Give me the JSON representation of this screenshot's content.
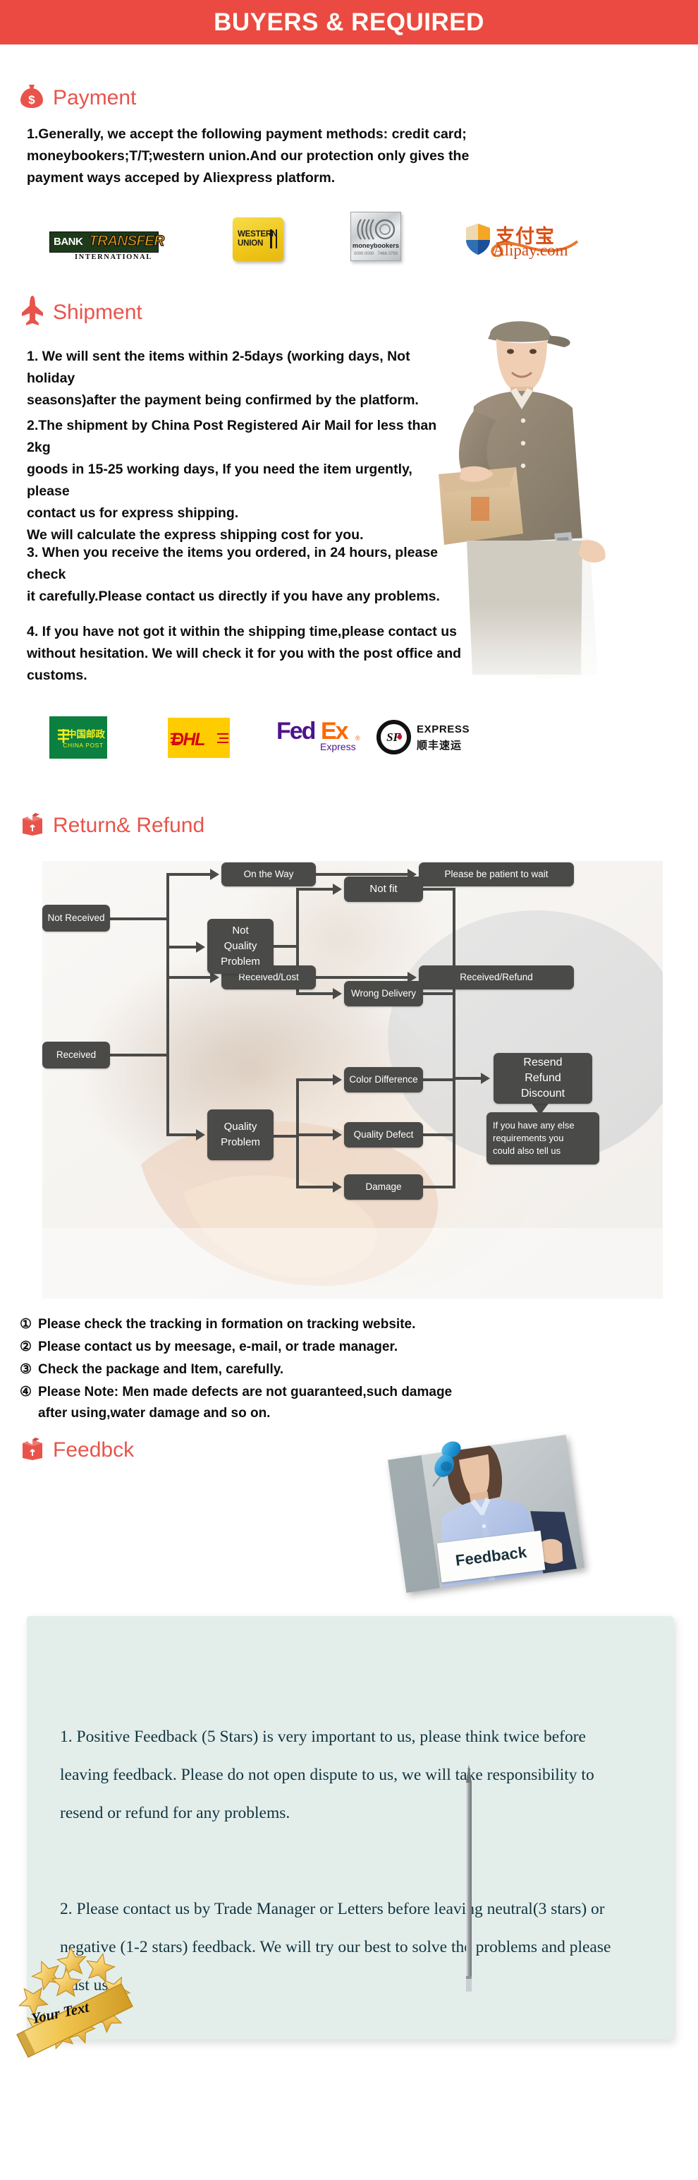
{
  "banner": {
    "title": "BUYERS & REQUIRED"
  },
  "colors": {
    "banner_bg": "#ea4a41",
    "heading_red": "#e8544b",
    "flow_node": "#4a4a48",
    "feedback_panel": "#e3eeeb",
    "feedback_text": "#12343f"
  },
  "sections": {
    "payment": {
      "icon": "money-bag-icon",
      "heading": "Payment",
      "paragraph": "1.Generally, we accept the following payment methods: credit card;\nmoneybookers;T/T;western union.And our protection only gives the\npayment ways acceped by Aliexpress platform.",
      "logos": [
        {
          "name": "bank-transfer-logo",
          "line1": "BANK",
          "line2": "TRANSFER",
          "line3": "INTERNATIONAL"
        },
        {
          "name": "western-union-logo",
          "line1": "WESTERN",
          "line2": "UNION"
        },
        {
          "name": "moneybookers-logo",
          "label": "moneybookers",
          "num_left": "0000 0000",
          "num_right": "7466 0793"
        },
        {
          "name": "alipay-logo",
          "label": "Alipay.com",
          "cn": "支付宝"
        }
      ]
    },
    "shipment": {
      "icon": "airplane-icon",
      "heading": "Shipment",
      "paragraphs": [
        "1. We will sent the items within 2-5days (working days, Not holiday\nseasons)after the payment being confirmed by the platform.",
        "2.The shipment by China Post Registered Air Mail for less than  2kg\ngoods in 15-25 working days, If  you need the item urgently, please\ncontact us for express shipping.\nWe will calculate the express shipping cost for you.",
        "3. When you receive the items you ordered, in 24 hours, please check\n it carefully.Please contact us directly if you have any problems.",
        "4. If you have not got it within the shipping time,please contact us\nwithout hesitation. We will check it for you with the post office and\ncustoms."
      ],
      "logos": [
        {
          "name": "china-post-logo",
          "cn": "中国邮政",
          "en": "CHINA POST"
        },
        {
          "name": "dhl-logo",
          "label": "DHL"
        },
        {
          "name": "fedex-logo",
          "part1": "Fed",
          "part2": "Ex",
          "reg": "®",
          "sub": "Express"
        },
        {
          "name": "sf-express-logo",
          "mark": "SF",
          "line1": "EXPRESS",
          "line2": "顺丰速运"
        }
      ]
    },
    "return_refund": {
      "icon": "return-box-icon",
      "heading": "Return& Refund",
      "flowchart": {
        "type": "flow",
        "nodes": [
          {
            "id": "not-received",
            "label": "Not Received"
          },
          {
            "id": "on-the-way",
            "label": "On the Way"
          },
          {
            "id": "please-wait",
            "label": "Please be patient to wait"
          },
          {
            "id": "received-lost",
            "label": "Received/Lost"
          },
          {
            "id": "received-refund",
            "label": "Received/Refund"
          },
          {
            "id": "received",
            "label": "Received"
          },
          {
            "id": "not-quality-problem",
            "label": "Not\nQuality\nProblem"
          },
          {
            "id": "quality-problem",
            "label": "Quality\nProblem"
          },
          {
            "id": "not-fit",
            "label": "Not fit"
          },
          {
            "id": "wrong-delivery",
            "label": "Wrong Delivery"
          },
          {
            "id": "color-difference",
            "label": "Color Difference"
          },
          {
            "id": "quality-defect",
            "label": "Quality Defect"
          },
          {
            "id": "damage",
            "label": "Damage"
          },
          {
            "id": "resend-refund-discount",
            "label": "Resend\nRefund\nDiscount"
          },
          {
            "id": "any-else-requirements",
            "label": "If you have any else\nrequirements you\ncould also tell us"
          }
        ],
        "edges": [
          [
            "not-received",
            "on-the-way"
          ],
          [
            "on-the-way",
            "please-wait"
          ],
          [
            "not-received",
            "received-lost"
          ],
          [
            "received-lost",
            "received-refund"
          ],
          [
            "received",
            "not-quality-problem"
          ],
          [
            "received",
            "quality-problem"
          ],
          [
            "not-quality-problem",
            "not-fit"
          ],
          [
            "not-quality-problem",
            "wrong-delivery"
          ],
          [
            "quality-problem",
            "color-difference"
          ],
          [
            "quality-problem",
            "quality-defect"
          ],
          [
            "quality-problem",
            "damage"
          ],
          [
            "not-fit",
            "resend-refund-discount"
          ],
          [
            "wrong-delivery",
            "resend-refund-discount"
          ],
          [
            "color-difference",
            "resend-refund-discount"
          ],
          [
            "quality-defect",
            "resend-refund-discount"
          ],
          [
            "damage",
            "resend-refund-discount"
          ]
        ]
      },
      "notes": [
        {
          "marker": "①",
          "text": "Please check the tracking in formation on tracking website."
        },
        {
          "marker": "②",
          "text": "Please contact us by meesage, e-mail, or trade manager."
        },
        {
          "marker": "③",
          "text": "Check the package and Item, carefully."
        },
        {
          "marker": "④",
          "text": "Please Note: Men made defects  are not guaranteed,such damage\n  after using,water damage and so on."
        }
      ]
    },
    "feedback": {
      "icon": "return-box-icon",
      "heading": "Feedbck",
      "photo_sign_label": "Feedback",
      "paragraphs": [
        "1. Positive Feedback (5 Stars) is very important to us, please think twice before leaving feedback. Please do not open dispute to us,   we will take responsibility to resend or refund for any problems.",
        "2. Please contact us by Trade Manager or Letters before leaving neutral(3 stars) or negative (1-2 stars) feedback. We will try our best to solve the problems and please trust us"
      ],
      "seal_text": "Your Text"
    }
  }
}
